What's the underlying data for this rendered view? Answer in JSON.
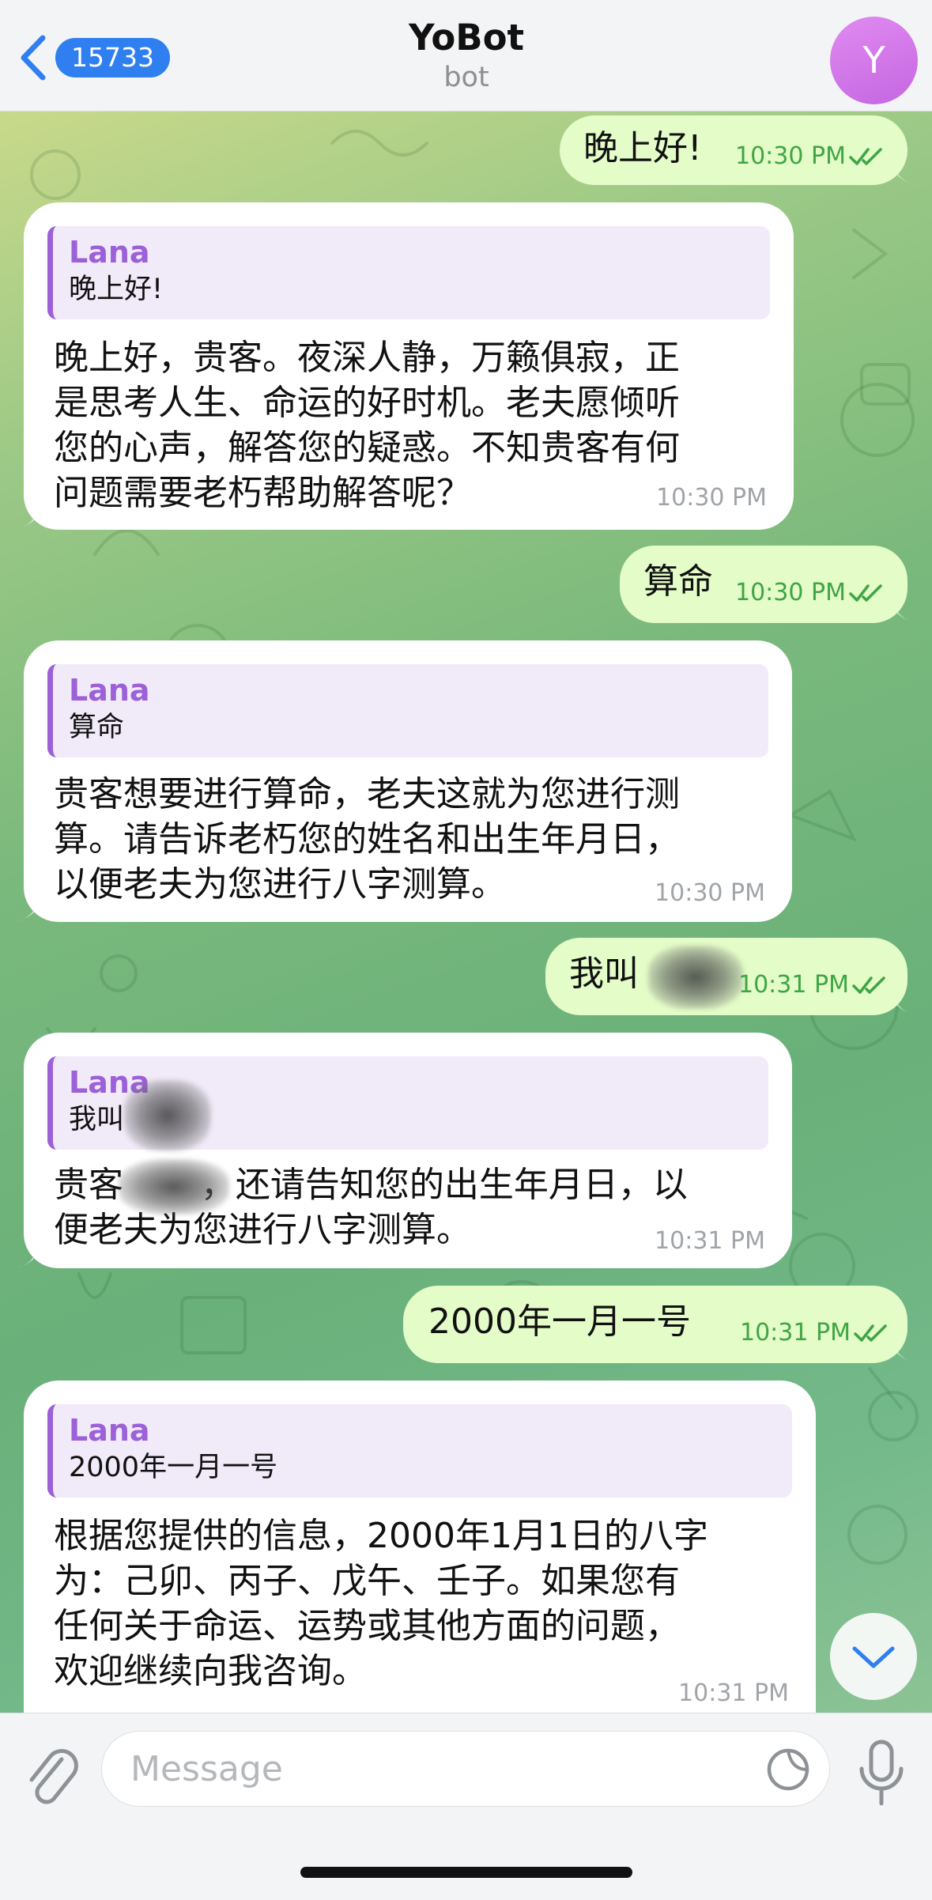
{
  "header": {
    "back_count": "15733",
    "title": "YoBot",
    "subtitle": "bot",
    "avatar_letter": "Y"
  },
  "messages": [
    {
      "direction": "out",
      "text": "晚上好!",
      "time": "10:30 PM",
      "status": "read"
    },
    {
      "direction": "in",
      "quote_name": "Lana",
      "quote_text": "晚上好!",
      "text": "晚上好，贵客。夜深人静，万籁俱寂，正\n是思考人生、命运的好时机。老夫愿倾听\n您的心声，解答您的疑惑。不知贵客有何\n问题需要老朽帮助解答呢？",
      "time": "10:30 PM"
    },
    {
      "direction": "out",
      "text": "算命",
      "time": "10:30 PM",
      "status": "read"
    },
    {
      "direction": "in",
      "quote_name": "Lana",
      "quote_text": "算命",
      "text": "贵客想要进行算命，老夫这就为您进行测\n算。请告诉老朽您的姓名和出生年月日，\n以便老夫为您进行八字测算。",
      "time": "10:30 PM"
    },
    {
      "direction": "out",
      "text": "我叫",
      "time": "10:31 PM",
      "status": "read"
    },
    {
      "direction": "in",
      "quote_name": "Lana",
      "quote_text": "我叫",
      "text": "贵客       ，还请告知您的出生年月日，以\n便老夫为您进行八字测算。",
      "time": "10:31 PM"
    },
    {
      "direction": "out",
      "text": "2000年一月一号",
      "time": "10:31 PM",
      "status": "read"
    },
    {
      "direction": "in",
      "quote_name": "Lana",
      "quote_text": "2000年一月一号",
      "text": "根据您提供的信息，2000年1月1日的八字\n为：己卯、丙子、戊午、壬子。如果您有\n任何关于命运、运势或其他方面的问题，\n欢迎继续向我咨询。",
      "time": "10:31 PM"
    }
  ],
  "composer": {
    "placeholder": "Message"
  },
  "icons": {
    "back": "chevron-left-icon",
    "attach": "paperclip-icon",
    "sticker": "sticker-icon",
    "mic": "microphone-icon",
    "scroll": "chevron-down-icon",
    "read": "double-check-icon"
  },
  "colors": {
    "accent": "#2f7ff0",
    "outgoing_bubble": "#e3fcc8",
    "incoming_bubble": "#ffffff",
    "quote_accent": "#9c60d8",
    "time_outgoing": "#3fa545"
  }
}
